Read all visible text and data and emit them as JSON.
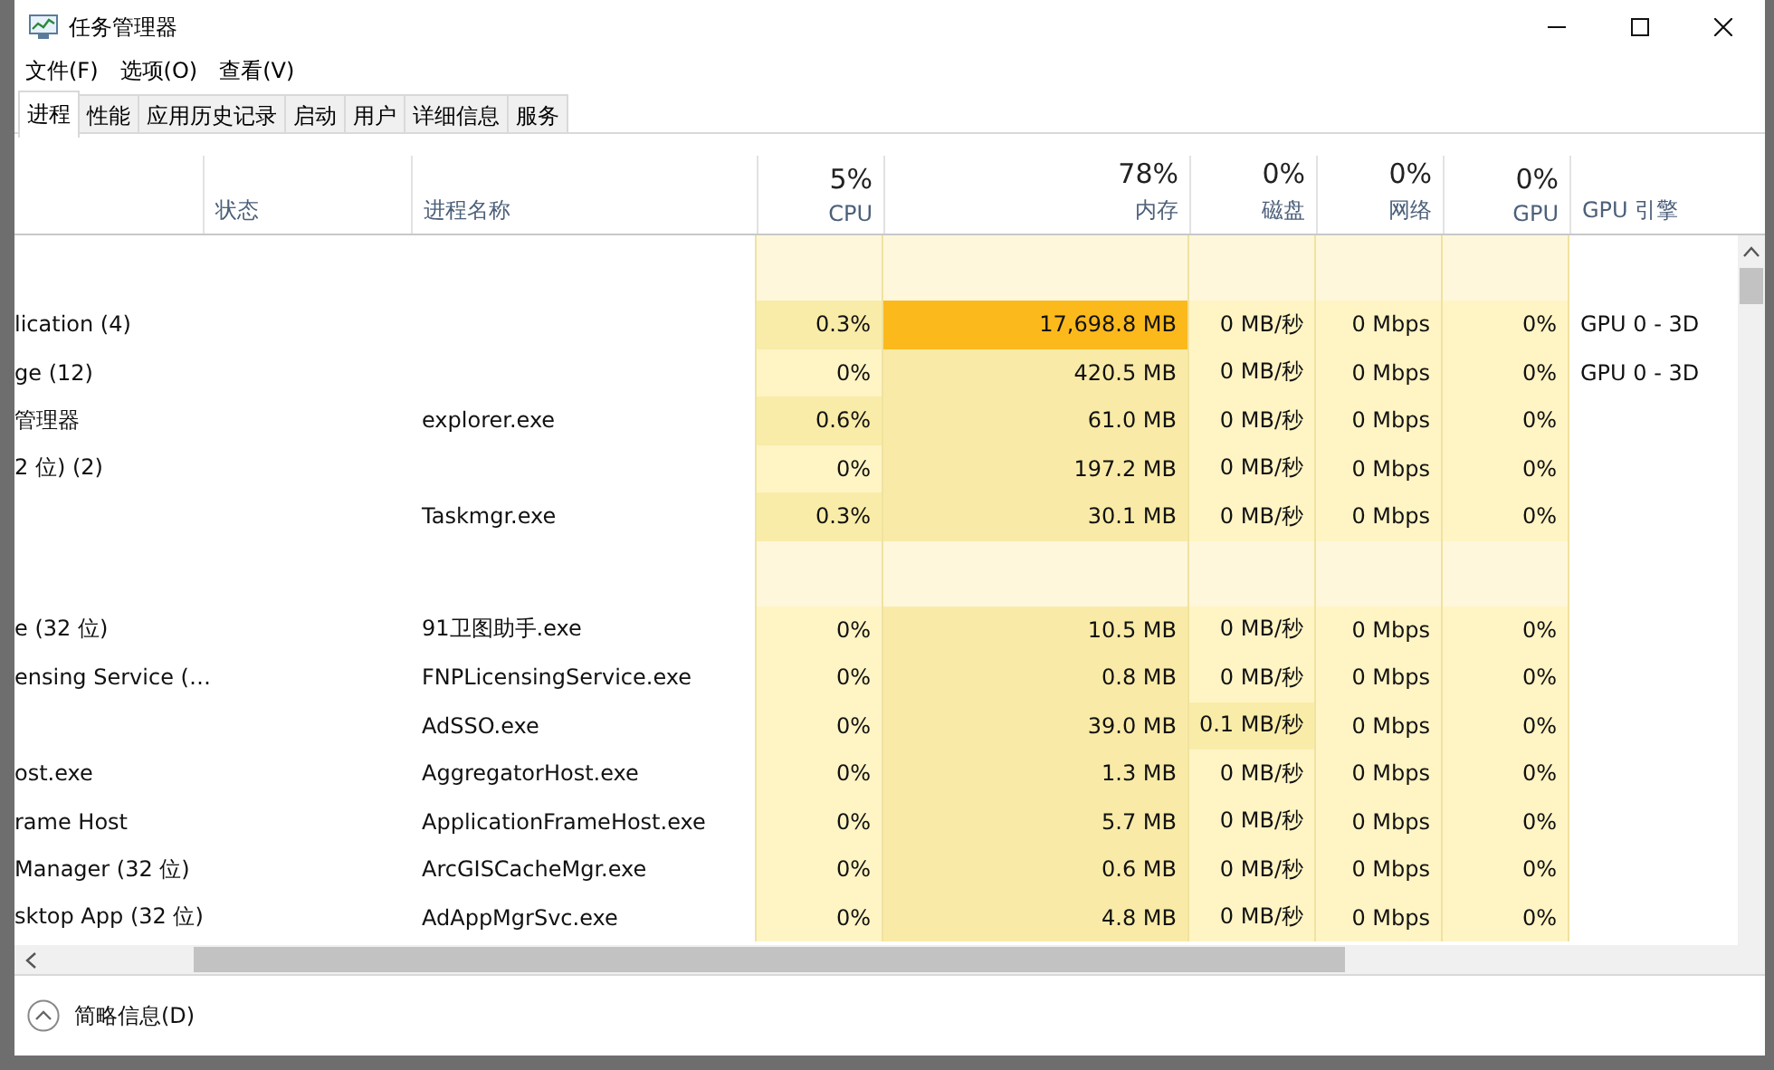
{
  "window": {
    "title": "任务管理器"
  },
  "menu": [
    "文件(F)",
    "选项(O)",
    "查看(V)"
  ],
  "tabs": [
    {
      "label": "进程",
      "selected": true
    },
    {
      "label": "性能",
      "selected": false
    },
    {
      "label": "应用历史记录",
      "selected": false
    },
    {
      "label": "启动",
      "selected": false
    },
    {
      "label": "用户",
      "selected": false
    },
    {
      "label": "详细信息",
      "selected": false
    },
    {
      "label": "服务",
      "selected": false
    }
  ],
  "columns": [
    {
      "kind": "text"
    },
    {
      "kind": "text",
      "label": "状态"
    },
    {
      "kind": "text",
      "label": "进程名称"
    },
    {
      "kind": "metric",
      "summary": "5%",
      "label": "CPU"
    },
    {
      "kind": "metric",
      "summary": "78%",
      "label": "内存"
    },
    {
      "kind": "metric",
      "summary": "0%",
      "label": "磁盘"
    },
    {
      "kind": "metric",
      "summary": "0%",
      "label": "网络"
    },
    {
      "kind": "metric",
      "summary": "0%",
      "label": "GPU"
    },
    {
      "kind": "text",
      "label": "GPU 引擎"
    }
  ],
  "rows": [
    {
      "kind": "group"
    },
    {
      "kind": "process",
      "name": "lication (4)",
      "cpu": {
        "value": "0.3%",
        "color": "#f9eca8"
      },
      "memory": {
        "value": "17,698.8 MB",
        "color": "#fcb91c"
      },
      "disk": {
        "value": "0 MB/秒",
        "color": "#fff4c4"
      },
      "network": {
        "value": "0 Mbps",
        "color": "#fff4c4"
      },
      "gpu": {
        "value": "0%",
        "color": "#fff4c4"
      },
      "engine": "GPU 0 - 3D"
    },
    {
      "kind": "process",
      "name": "ge (12)",
      "cpu": {
        "value": "0%",
        "color": "#fff4c4"
      },
      "memory": {
        "value": "420.5 MB",
        "color": "#f9eba7"
      },
      "disk": {
        "value": "0 MB/秒",
        "color": "#fff4c4"
      },
      "network": {
        "value": "0 Mbps",
        "color": "#fff4c4"
      },
      "gpu": {
        "value": "0%",
        "color": "#fff4c4"
      },
      "engine": "GPU 0 - 3D"
    },
    {
      "kind": "process",
      "name": "管理器",
      "process": "explorer.exe",
      "cpu": {
        "value": "0.6%",
        "color": "#f9eca8"
      },
      "memory": {
        "value": "61.0 MB",
        "color": "#f9eba7"
      },
      "disk": {
        "value": "0 MB/秒",
        "color": "#fff4c4"
      },
      "network": {
        "value": "0 Mbps",
        "color": "#fff4c4"
      },
      "gpu": {
        "value": "0%",
        "color": "#fff4c4"
      }
    },
    {
      "kind": "process",
      "name": "2 位) (2)",
      "cpu": {
        "value": "0%",
        "color": "#fff4c4"
      },
      "memory": {
        "value": "197.2 MB",
        "color": "#f9eba7"
      },
      "disk": {
        "value": "0 MB/秒",
        "color": "#fff4c4"
      },
      "network": {
        "value": "0 Mbps",
        "color": "#fff4c4"
      },
      "gpu": {
        "value": "0%",
        "color": "#fff4c4"
      }
    },
    {
      "kind": "process",
      "process": "Taskmgr.exe",
      "cpu": {
        "value": "0.3%",
        "color": "#f9eca8"
      },
      "memory": {
        "value": "30.1 MB",
        "color": "#f9eba7"
      },
      "disk": {
        "value": "0 MB/秒",
        "color": "#fff4c4"
      },
      "network": {
        "value": "0 Mbps",
        "color": "#fff4c4"
      },
      "gpu": {
        "value": "0%",
        "color": "#fff4c4"
      }
    },
    {
      "kind": "group"
    },
    {
      "kind": "process",
      "name": "e (32 位)",
      "process": "91卫图助手.exe",
      "cpu": {
        "value": "0%",
        "color": "#fff4c4"
      },
      "memory": {
        "value": "10.5 MB",
        "color": "#f9eba7"
      },
      "disk": {
        "value": "0 MB/秒",
        "color": "#fff4c4"
      },
      "network": {
        "value": "0 Mbps",
        "color": "#fff4c4"
      },
      "gpu": {
        "value": "0%",
        "color": "#fff4c4"
      }
    },
    {
      "kind": "process",
      "name": "ensing Service (…",
      "process": "FNPLicensingService.exe",
      "cpu": {
        "value": "0%",
        "color": "#fff4c4"
      },
      "memory": {
        "value": "0.8 MB",
        "color": "#f9eba7"
      },
      "disk": {
        "value": "0 MB/秒",
        "color": "#fff4c4"
      },
      "network": {
        "value": "0 Mbps",
        "color": "#fff4c4"
      },
      "gpu": {
        "value": "0%",
        "color": "#fff4c4"
      }
    },
    {
      "kind": "process",
      "process": "AdSSO.exe",
      "cpu": {
        "value": "0%",
        "color": "#fff4c4"
      },
      "memory": {
        "value": "39.0 MB",
        "color": "#f9eba7"
      },
      "disk": {
        "value": "0.1 MB/秒",
        "color": "#f9eca8"
      },
      "network": {
        "value": "0 Mbps",
        "color": "#fff4c4"
      },
      "gpu": {
        "value": "0%",
        "color": "#fff4c4"
      }
    },
    {
      "kind": "process",
      "name": "ost.exe",
      "process": "AggregatorHost.exe",
      "cpu": {
        "value": "0%",
        "color": "#fff4c4"
      },
      "memory": {
        "value": "1.3 MB",
        "color": "#f9eba7"
      },
      "disk": {
        "value": "0 MB/秒",
        "color": "#fff4c4"
      },
      "network": {
        "value": "0 Mbps",
        "color": "#fff4c4"
      },
      "gpu": {
        "value": "0%",
        "color": "#fff4c4"
      }
    },
    {
      "kind": "process",
      "name": "rame Host",
      "process": "ApplicationFrameHost.exe",
      "cpu": {
        "value": "0%",
        "color": "#fff4c4"
      },
      "memory": {
        "value": "5.7 MB",
        "color": "#f9eba7"
      },
      "disk": {
        "value": "0 MB/秒",
        "color": "#fff4c4"
      },
      "network": {
        "value": "0 Mbps",
        "color": "#fff4c4"
      },
      "gpu": {
        "value": "0%",
        "color": "#fff4c4"
      }
    },
    {
      "kind": "process",
      "name": "Manager (32 位)",
      "process": "ArcGISCacheMgr.exe",
      "cpu": {
        "value": "0%",
        "color": "#fff4c4"
      },
      "memory": {
        "value": "0.6 MB",
        "color": "#f9eba7"
      },
      "disk": {
        "value": "0 MB/秒",
        "color": "#fff4c4"
      },
      "network": {
        "value": "0 Mbps",
        "color": "#fff4c4"
      },
      "gpu": {
        "value": "0%",
        "color": "#fff4c4"
      }
    },
    {
      "kind": "process",
      "name": "sktop App (32 位)",
      "process": "AdAppMgrSvc.exe",
      "cpu": {
        "value": "0%",
        "color": "#fff4c4"
      },
      "memory": {
        "value": "4.8 MB",
        "color": "#f9eba7"
      },
      "disk": {
        "value": "0 MB/秒",
        "color": "#fff4c4"
      },
      "network": {
        "value": "0 Mbps",
        "color": "#fff4c4"
      },
      "gpu": {
        "value": "0%",
        "color": "#fff4c4"
      }
    }
  ],
  "footer": {
    "label": "简略信息(D)"
  }
}
